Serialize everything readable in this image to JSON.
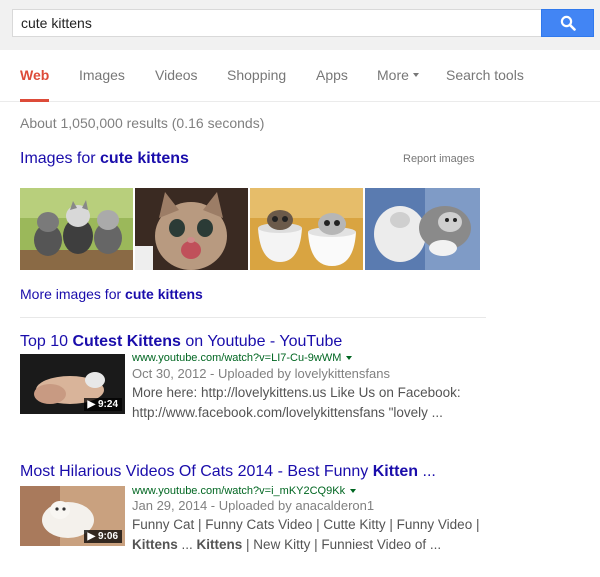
{
  "search": {
    "query": "cute kittens",
    "button_icon": "search-icon"
  },
  "tabs": [
    "Web",
    "Images",
    "Videos",
    "Shopping",
    "Apps",
    "More",
    "Search tools"
  ],
  "stats": "About 1,050,000 results (0.16 seconds)",
  "images_section": {
    "heading_prefix": "Images for ",
    "heading_query": "cute kittens",
    "report": "Report images",
    "more_prefix": "More images for ",
    "more_query": "cute kittens"
  },
  "results": [
    {
      "title_pre": "Top 10 ",
      "title_bold": "Cutest Kittens",
      "title_post": " on Youtube - YouTube",
      "url": "www.youtube.com/watch?v=LI7-Cu-9wWM",
      "meta": "Oct 30, 2012 - Uploaded by lovelykittensfans",
      "snippet": "More here: http://lovelykittens.us Like Us on Facebook: http://www.facebook.com/lovelykittensfans \"lovely ...",
      "duration": "▶ 9:24"
    },
    {
      "title_pre": "Most Hilarious Videos Of Cats 2014 - Best Funny ",
      "title_bold": "Kitten",
      "title_post": " ...",
      "url": "www.youtube.com/watch?v=i_mKY2CQ9Kk",
      "meta": "Jan 29, 2014 - Uploaded by anacalderon1",
      "snippet_parts": [
        "Funny Cat | Funny Cats Video | Cutte Kitty | Funny Video | ",
        "Kittens",
        " ... ",
        "Kittens",
        " | New Kitty | Funniest Video of ..."
      ],
      "duration": "▶ 9:06"
    }
  ],
  "colors": {
    "accent": "#dd4b39",
    "link": "#1a0dab",
    "url": "#006621",
    "search_button": "#4285f4"
  }
}
